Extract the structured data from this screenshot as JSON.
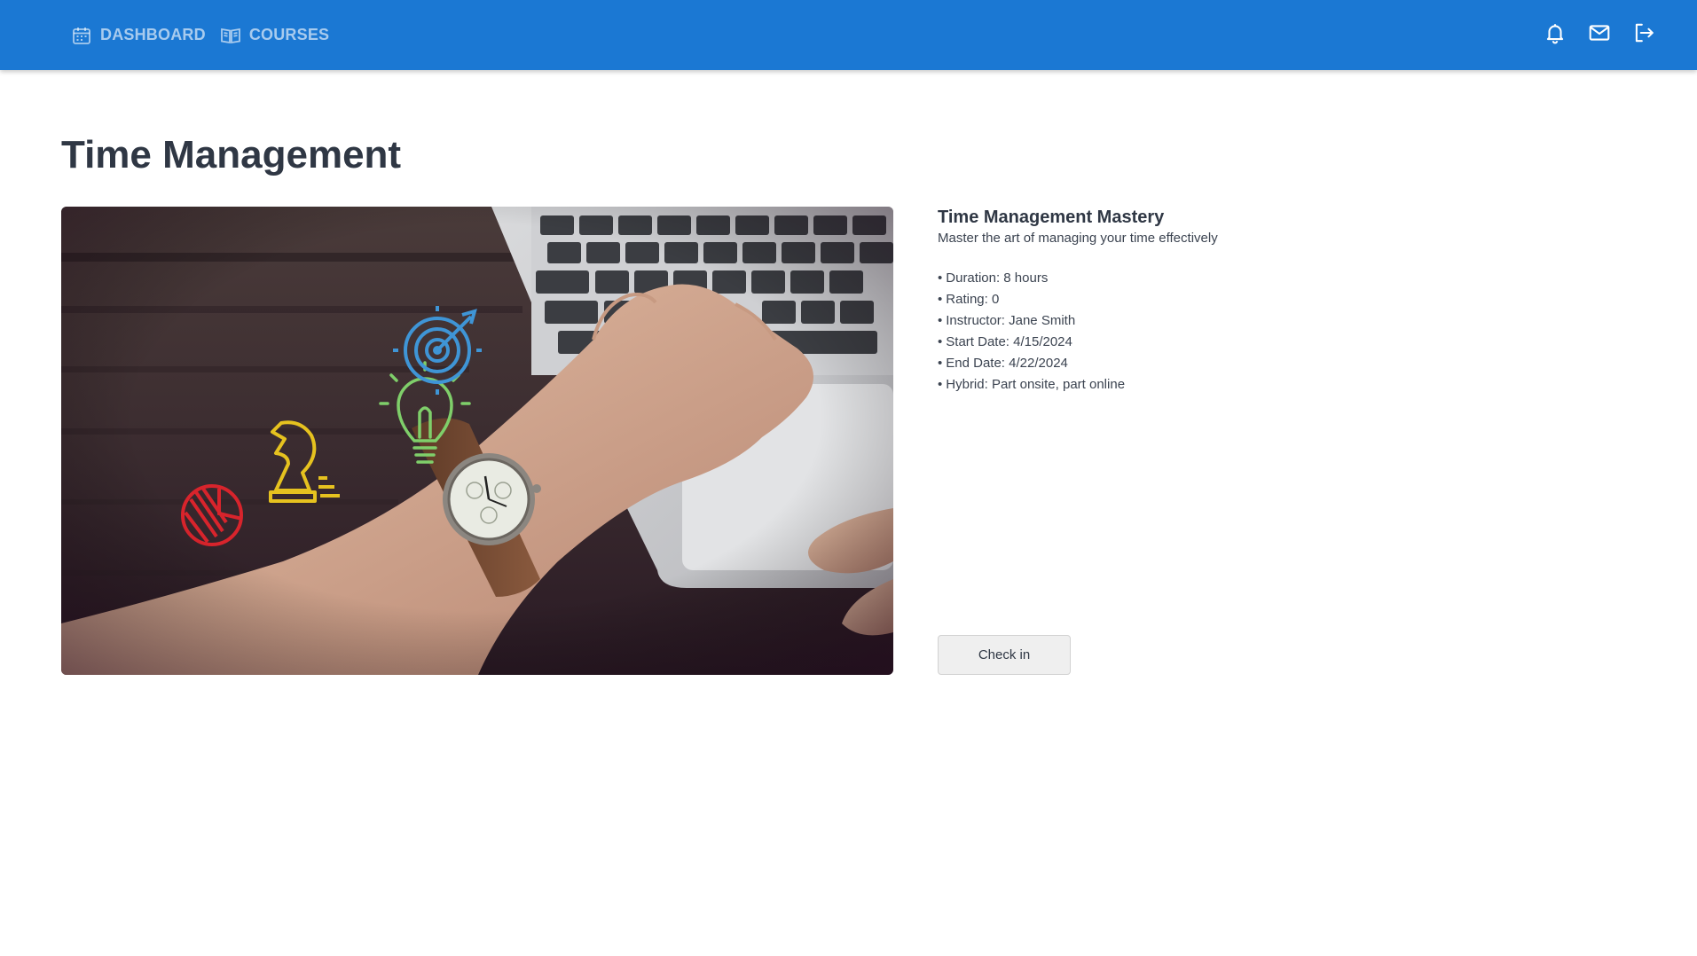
{
  "nav": {
    "items": [
      {
        "label": "DASHBOARD",
        "icon": "calendar-icon"
      },
      {
        "label": "COURSES",
        "icon": "book-open-icon"
      }
    ]
  },
  "header_actions": {
    "icons": [
      "bell-icon",
      "mail-icon",
      "logout-icon"
    ]
  },
  "page": {
    "title": "Time Management"
  },
  "course": {
    "name": "Time Management Mastery",
    "description": "Master the art of managing your time effectively",
    "details": [
      "Duration: 8 hours",
      "Rating: 0",
      "Instructor: Jane Smith",
      "Start Date: 4/15/2024",
      "End Date: 4/22/2024",
      "Hybrid: Part onsite, part online"
    ],
    "checkin_label": "Check in"
  },
  "colors": {
    "topbar": "#1b78d3",
    "title_text": "#2f3744"
  }
}
